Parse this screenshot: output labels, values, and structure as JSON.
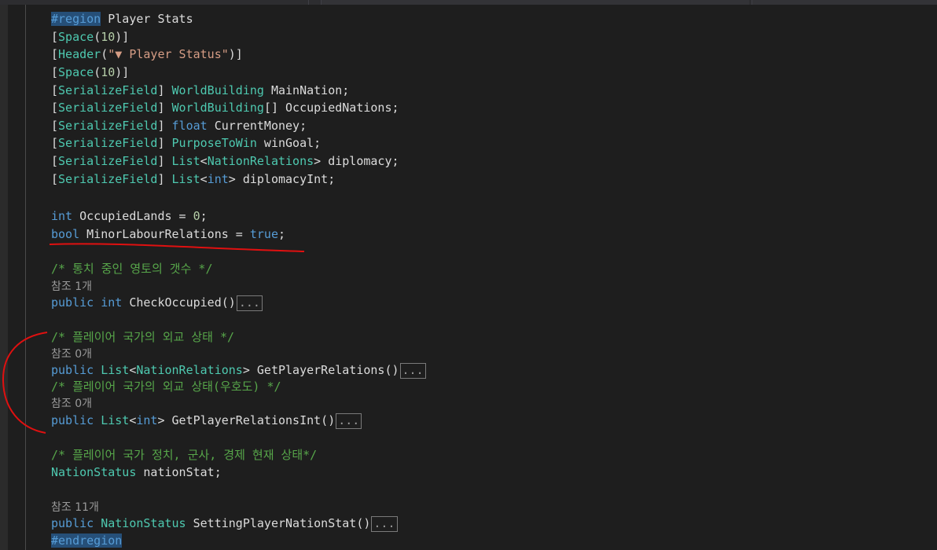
{
  "editor": {
    "region_start": "#region",
    "region_name": " Player Stats",
    "region_end": "#endregion",
    "collapsed_label": "...",
    "lines": {
      "space1": {
        "open": "[",
        "attr": "Space",
        "p1": "(",
        "num": "10",
        "p2": ")]"
      },
      "header": {
        "open": "[",
        "attr": "Header",
        "p1": "(",
        "str": "\"▼ Player Status\"",
        "p2": ")]"
      },
      "space2": {
        "open": "[",
        "attr": "Space",
        "p1": "(",
        "num": "10",
        "p2": ")]"
      },
      "f1": {
        "open": "[",
        "attr": "SerializeField",
        "close": "] ",
        "type": "WorldBuilding",
        "rest": " MainNation;"
      },
      "f2": {
        "open": "[",
        "attr": "SerializeField",
        "close": "] ",
        "type": "WorldBuilding",
        "rest": "[] OccupiedNations;"
      },
      "f3": {
        "open": "[",
        "attr": "SerializeField",
        "close": "] ",
        "kw": "float",
        "rest": " CurrentMoney;"
      },
      "f4": {
        "open": "[",
        "attr": "SerializeField",
        "close": "] ",
        "type": "PurposeToWin",
        "rest": " winGoal;"
      },
      "f5": {
        "open": "[",
        "attr": "SerializeField",
        "close": "] ",
        "type": "List",
        "lt": "<",
        "type2": "NationRelations",
        "rest": "> diplomacy;"
      },
      "f6": {
        "open": "[",
        "attr": "SerializeField",
        "close": "] ",
        "type": "List",
        "lt": "<",
        "kw": "int",
        "rest": "> diplomacyInt;"
      },
      "v1": {
        "kw": "int",
        "mid": " OccupiedLands = ",
        "num": "0",
        "end": ";"
      },
      "v2": {
        "kw": "bool",
        "mid": " MinorLabourRelations = ",
        "kw2": "true",
        "end": ";"
      },
      "c1": "/* 통치 중인 영토의 갯수 */",
      "lens1": "참조 1개",
      "m1": {
        "kw": "public",
        "sp": " ",
        "kw2": "int",
        "name": " CheckOccupied()"
      },
      "c2": "/* 플레이어 국가의 외교 상태 */",
      "lens2": "참조 0개",
      "m2": {
        "kw": "public",
        "sp": " ",
        "type": "List",
        "lt": "<",
        "type2": "NationRelations",
        "name": "> GetPlayerRelations()"
      },
      "c3": "/* 플레이어 국가의 외교 상태(우호도) */",
      "lens3": "참조 0개",
      "m3": {
        "kw": "public",
        "sp": " ",
        "type": "List",
        "lt": "<",
        "kw2": "int",
        "name": "> GetPlayerRelationsInt()"
      },
      "c4": "/* 플레이어 국가 정치, 군사, 경제 현재 상태*/",
      "f7": {
        "type": "NationStatus",
        "rest": " nationStat;"
      },
      "lens4": "참조 11개",
      "m4": {
        "kw": "public",
        "sp": " ",
        "type": "NationStatus",
        "name": " SettingPlayerNationStat()"
      }
    }
  },
  "colors": {
    "background": "#1e1e1e",
    "keyword": "#569cd6",
    "type": "#4ec9b0",
    "string": "#d69d85",
    "comment": "#57a64a",
    "annotation": "#e01010"
  }
}
